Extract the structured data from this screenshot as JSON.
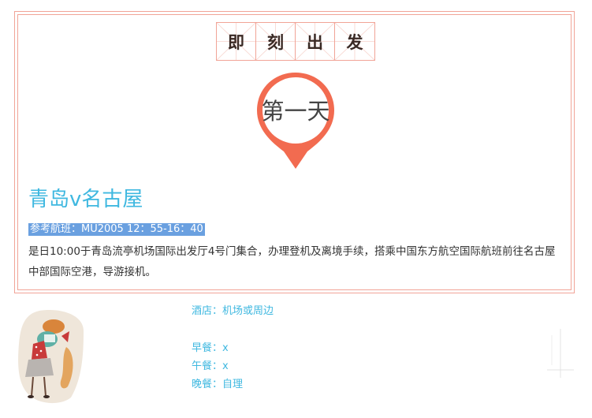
{
  "header": {
    "title_chars": [
      "即",
      "刻",
      "出",
      "发"
    ]
  },
  "day": {
    "label": "第一天"
  },
  "route": {
    "title": "青岛v名古屋"
  },
  "flight": {
    "reference": "参考航班：MU2005  12：55-16：40"
  },
  "description": "是日10:00于青岛流亭机场国际出发厅4号门集合，办理登机及离境手续，搭乘中国东方航空国际航班前往名古屋中部国际空港，导游接机。",
  "info": {
    "hotel": "酒店：机场或周边",
    "breakfast": "早餐：x",
    "lunch": "午餐：x",
    "dinner": "晚餐：自理"
  },
  "colors": {
    "border": "#f1a497",
    "pin": "#f26b50",
    "accent_text": "#3fb8e0",
    "highlight_bg": "#6aa0e0"
  }
}
